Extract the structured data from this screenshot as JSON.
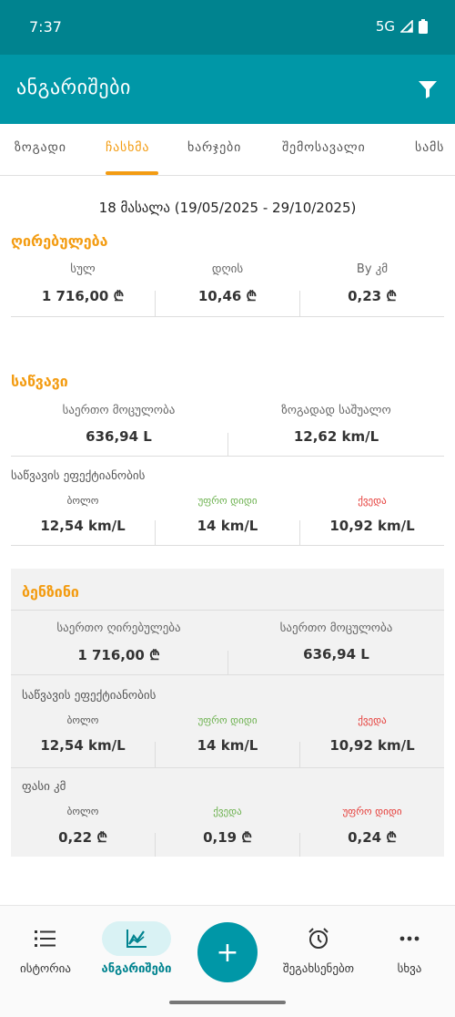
{
  "status_bar": {
    "time": "7:37",
    "network": "5G"
  },
  "app_bar": {
    "title": "ანგარიშები",
    "filter_icon": "filter-icon"
  },
  "tabs": [
    {
      "label": "ზოგადი"
    },
    {
      "label": "ჩასხმა"
    },
    {
      "label": "ხარჯები"
    },
    {
      "label": "შემოსავალი"
    },
    {
      "label": "სამს"
    }
  ],
  "active_tab": "ჩასხმა",
  "period": "18 მასალა (19/05/2025 - 29/10/2025)",
  "cost": {
    "title": "ღირებულება",
    "items": [
      {
        "label": "სულ",
        "value": "1 716,00 ₾"
      },
      {
        "label": "დღის",
        "value": "10,46 ₾"
      },
      {
        "label": "By კმ",
        "value": "0,23 ₾"
      }
    ]
  },
  "fuel": {
    "title": "საწვავი",
    "total_volume_label": "საერთო მოცულობა",
    "total_volume": "636,94 L",
    "avg_label": "ზოგადად საშუალო",
    "avg": "12,62 km/L",
    "efficiency_label": "საწვავის ეფექტიანობის",
    "efficiency": [
      {
        "label": "ბოლო",
        "value": "12,54 km/L",
        "color": "#555555"
      },
      {
        "label": "უფრო დიდი",
        "value": "14 km/L",
        "color": "#6ab04c"
      },
      {
        "label": "ქვედა",
        "value": "10,92 km/L",
        "color": "#e53935"
      }
    ]
  },
  "petrol": {
    "title": "ბენზინი",
    "total_cost_label": "საერთო ღირებულება",
    "total_cost": "1 716,00 ₾",
    "total_volume_label": "საერთო მოცულობა",
    "total_volume": "636,94 L",
    "efficiency_label": "საწვავის ეფექტიანობის",
    "efficiency": [
      {
        "label": "ბოლო",
        "value": "12,54 km/L"
      },
      {
        "label": "უფრო დიდი",
        "value": "14 km/L"
      },
      {
        "label": "ქვედა",
        "value": "10,92 km/L"
      }
    ],
    "price_label": "ფასი კმ",
    "price": [
      {
        "label": "ბოლო",
        "value": "0,22 ₾"
      },
      {
        "label": "ქვედა",
        "value": "0,19 ₾"
      },
      {
        "label": "უფრო დიდი",
        "value": "0,24 ₾"
      }
    ]
  },
  "bottom_nav": {
    "history": "ისტორია",
    "reports": "ანგარიშები",
    "add": "+",
    "reminders": "შეგახსენებთ",
    "more": "სხვა"
  },
  "colors": {
    "primary": "#0097a7",
    "primary_dark": "#00838f",
    "accent": "#f39c12",
    "green": "#6ab04c",
    "red": "#e53935"
  }
}
